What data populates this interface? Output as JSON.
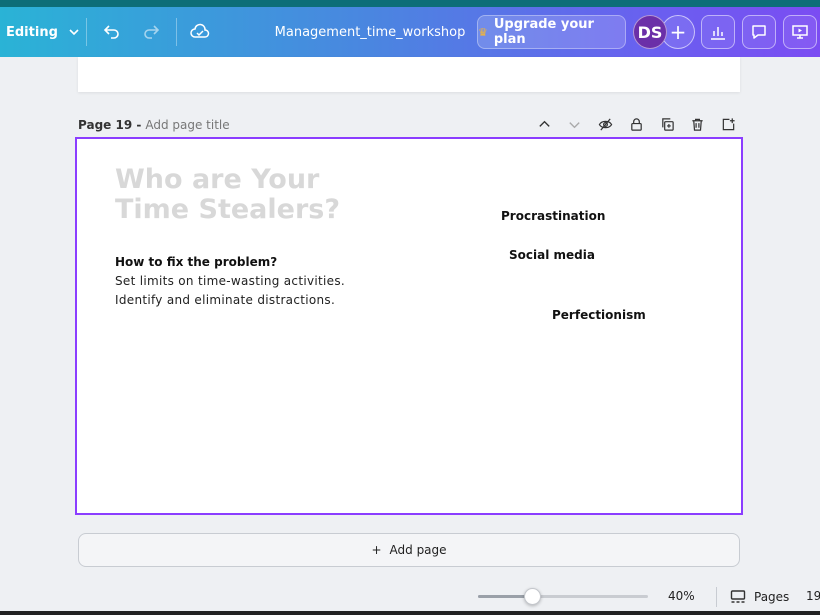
{
  "topbar": {
    "editing_label": "Editing",
    "doc_title": "Management_time_workshop",
    "upgrade_label": "Upgrade your plan",
    "avatar_initials": "DS",
    "plus_label": "+"
  },
  "page": {
    "number_label": "Page 19 -",
    "title_placeholder": "Add page title"
  },
  "slide": {
    "heading_line1": "Who are Your",
    "heading_line2": "Time Stealers?",
    "fix_heading": "How to fix the problem?",
    "body_lines": [
      "Set limits on time-wasting activities.",
      "Identify and eliminate distractions."
    ],
    "stealers": [
      "Procrastination",
      "Social media",
      "Perfectionism"
    ]
  },
  "add_page_label": "Add page",
  "bottombar": {
    "zoom_value": 40,
    "zoom_label": "40%",
    "pages_label": "Pages",
    "page_number": "19"
  },
  "colors": {
    "accent": "#8b3dff",
    "avatar": "#6b2fa8",
    "heading_text": "#d8d8d8"
  },
  "icons": [
    "chevron-down-icon",
    "undo-icon",
    "redo-icon",
    "cloud-check-icon",
    "crown-icon",
    "chart-icon",
    "comment-icon",
    "present-icon",
    "chevron-up-icon",
    "eye-off-icon",
    "lock-icon",
    "duplicate-icon",
    "trash-icon",
    "add-page-icon",
    "pages-grid-icon"
  ]
}
